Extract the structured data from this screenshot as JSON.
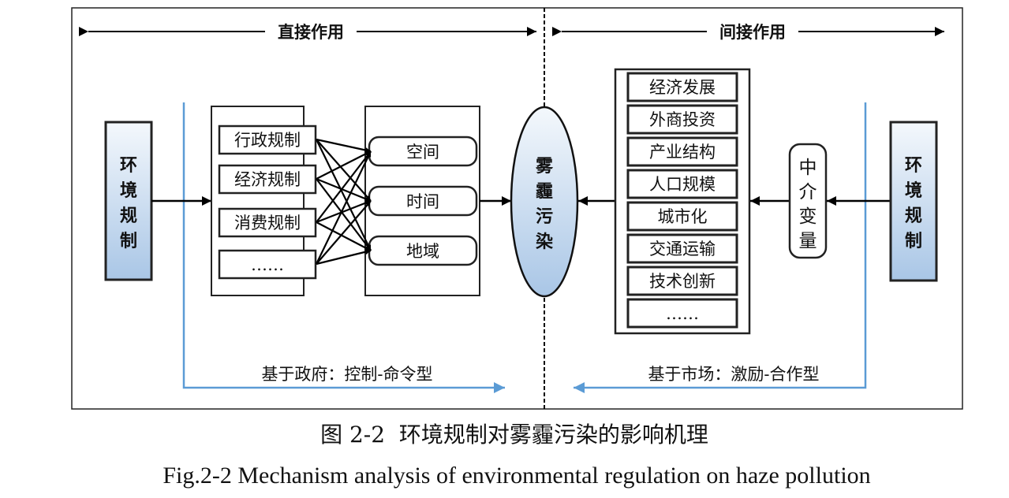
{
  "header": {
    "direct_label": "直接作用",
    "indirect_label": "间接作用"
  },
  "left": {
    "source": [
      "环",
      "境",
      "规",
      "制"
    ],
    "regulations": [
      "行政规制",
      "经济规制",
      "消费规制",
      "……"
    ],
    "dimensions": [
      "空间",
      "时间",
      "地域"
    ],
    "bottom_label": "基于政府：控制-命令型"
  },
  "center": {
    "outcome": [
      "雾",
      "霾",
      "污",
      "染"
    ]
  },
  "right": {
    "channels": [
      "经济发展",
      "外商投资",
      "产业结构",
      "人口规模",
      "城市化",
      "交通运输",
      "技术创新",
      "……"
    ],
    "mediator": [
      "中",
      "介",
      "变",
      "量"
    ],
    "source": [
      "环",
      "境",
      "规",
      "制"
    ],
    "bottom_label": "基于市场：激励-合作型"
  },
  "caption": {
    "zh": "图 2-2  环境规制对雾霾污染的影响机理",
    "en": "Fig.2-2 Mechanism analysis of environmental regulation on haze pollution"
  },
  "colors": {
    "blue_line": "#5b9bd5",
    "fill_top": "#f4f8fc",
    "fill_bottom": "#a9c6e6"
  }
}
